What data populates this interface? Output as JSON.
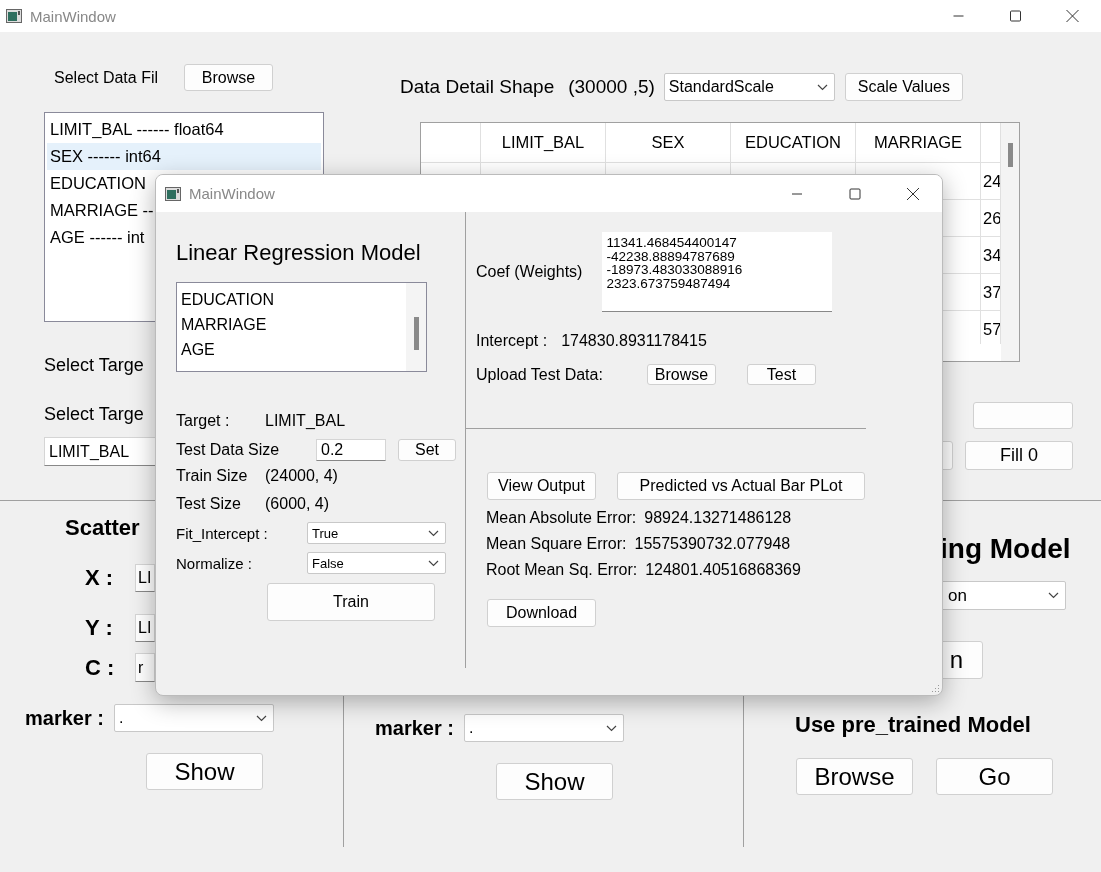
{
  "main_window": {
    "title": "MainWindow",
    "data_panel": {
      "select_label": "Select Data Fil",
      "browse": "Browse",
      "columns_list": [
        {
          "text": "LIMIT_BAL ------ float64",
          "selected": false
        },
        {
          "text": "SEX ------ int64",
          "selected": true
        },
        {
          "text": "EDUCATION",
          "selected": false
        },
        {
          "text": "MARRIAGE --",
          "selected": false
        },
        {
          "text": "AGE ------ int",
          "selected": false
        }
      ],
      "target_label_1": "Select Targe",
      "target_label_2": "Select Targe",
      "target_value": "LIMIT_BAL"
    },
    "detail": {
      "label": "Data Detail Shape",
      "shape": "(30000 ,5)",
      "scaler": "StandardScale",
      "scale_button": "Scale Values",
      "table": {
        "columns": [
          "LIMIT_BAL",
          "SEX",
          "EDUCATION",
          "MARRIAGE"
        ],
        "column_5_cells": [
          "24",
          "26",
          "34",
          "37",
          "57"
        ]
      },
      "fill_button": "Fill 0"
    },
    "scatter": {
      "title": "Scatter",
      "x_label": "X :",
      "x_value": "LI",
      "y_label": "Y :",
      "y_value": "LI",
      "c_label": "C :",
      "c_value": "r",
      "marker_label": "marker :",
      "marker_value": ".",
      "show": "Show"
    },
    "plot_2": {
      "marker_label": "marker :",
      "marker_value": ".",
      "show": "Show"
    },
    "model_panel": {
      "title": "ing Model",
      "model_value": "on",
      "button": "n",
      "pretrained_title": "Use pre_trained Model",
      "browse": "Browse",
      "go": "Go"
    }
  },
  "dialog": {
    "title": "MainWindow",
    "heading": "Linear Regression Model",
    "features": [
      "EDUCATION",
      "MARRIAGE",
      "AGE"
    ],
    "target_label": "Target :",
    "target_value": "LIMIT_BAL",
    "test_size_label": "Test Data Size",
    "test_size_value": "0.2",
    "set_button": "Set",
    "train_size_label": "Train Size",
    "train_size_value": "(24000, 4)",
    "test_shape_label": "Test Size",
    "test_shape_value": "(6000, 4)",
    "fit_intercept_label": "Fit_Intercept :",
    "fit_intercept_value": "True",
    "normalize_label": "Normalize :",
    "normalize_value": "False",
    "train_button": "Train",
    "coef_label": "Coef (Weights)",
    "coef_lines": [
      "11341.468454400147",
      "-42238.88894787689",
      "-18973.483033088916",
      "2323.673759487494"
    ],
    "intercept_label": "Intercept :",
    "intercept_value": "174830.8931178415",
    "upload_label": "Upload Test Data:",
    "browse_button": "Browse",
    "test_button": "Test",
    "view_output_button": "View Output",
    "plot_button": "Predicted vs Actual Bar PLot",
    "metrics": [
      {
        "label": "Mean Absolute Error:",
        "value": "98924.13271486128"
      },
      {
        "label": "Mean Square Error:",
        "value": "15575390732.077948"
      },
      {
        "label": "Root Mean Sq. Error:",
        "value": "124801.40516868369"
      }
    ],
    "download_button": "Download"
  }
}
